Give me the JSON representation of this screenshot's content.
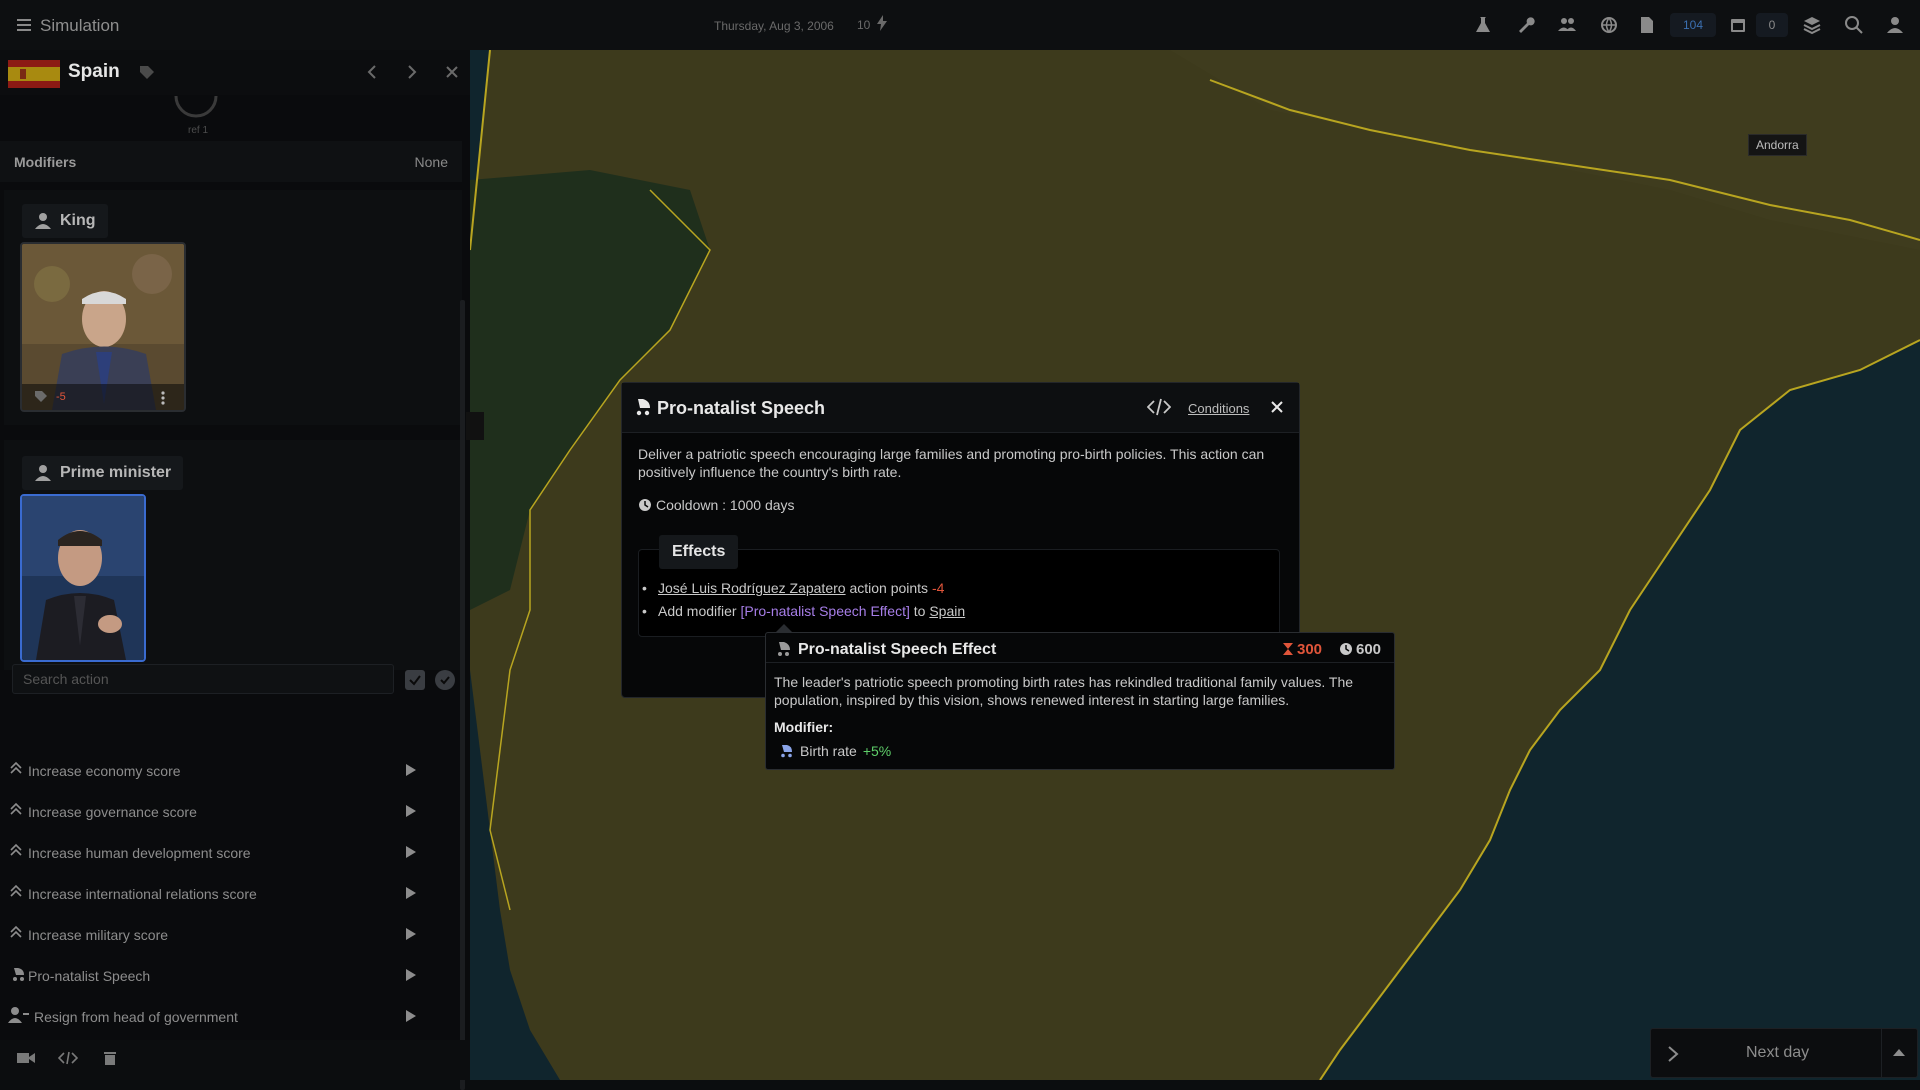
{
  "topbar": {
    "title": "Simulation",
    "date": "Thursday, Aug 3, 2006",
    "speed": "10",
    "badge_count": "104",
    "calendar_count": "0"
  },
  "country": {
    "name": "Spain",
    "gauge_text": "ref 1"
  },
  "modifiers": {
    "label": "Modifiers",
    "value": "None"
  },
  "king": {
    "role": "King",
    "stat": "-5"
  },
  "prime_minister": {
    "role": "Prime minister"
  },
  "search": {
    "placeholder": "Search action"
  },
  "actions": [
    {
      "label": "Increase economy score",
      "icon": "double-chevron-up-icon"
    },
    {
      "label": "Increase governance score",
      "icon": "double-chevron-up-icon"
    },
    {
      "label": "Increase human development score",
      "icon": "double-chevron-up-icon"
    },
    {
      "label": "Increase international relations score",
      "icon": "double-chevron-up-icon"
    },
    {
      "label": "Increase military score",
      "icon": "double-chevron-up-icon"
    },
    {
      "label": "Pro-natalist Speech",
      "icon": "baby-carriage-icon"
    },
    {
      "label": "Resign from head of government",
      "icon": "user-minus-icon"
    }
  ],
  "modal": {
    "title": "Pro-natalist Speech",
    "conditions": "Conditions",
    "description": "Deliver a patriotic speech encouraging large families and promoting pro-birth policies. This action can positively influence the country's birth rate.",
    "cooldown": "Cooldown : 1000 days",
    "effects_label": "Effects",
    "effects": {
      "line1_person": "José Luis Rodríguez Zapatero",
      "line1_text": "action points",
      "line1_value": "-4",
      "line2_prefix": "Add modifier",
      "line2_modifier": "[Pro-natalist Speech Effect]",
      "line2_to": "to",
      "line2_country": "Spain"
    }
  },
  "tooltip": {
    "title": "Pro-natalist Speech Effect",
    "duration": "300",
    "cooldown": "600",
    "description": "The leader's patriotic speech promoting birth rates has rekindled traditional family values. The population, inspired by this vision, shows renewed interest in starting large families.",
    "modifier_label": "Modifier:",
    "stat_name": "Birth rate",
    "stat_value": "+5%"
  },
  "map": {
    "label_andorra": "Andorra"
  },
  "next_day": {
    "label": "Next day"
  },
  "colors": {
    "accent_negative": "#e0553a",
    "accent_positive": "#5fcf6a",
    "modifier_purple": "#a77ee8",
    "map_land": "#3d3a1c",
    "map_sea": "#10252d",
    "map_border": "#b8a520"
  }
}
